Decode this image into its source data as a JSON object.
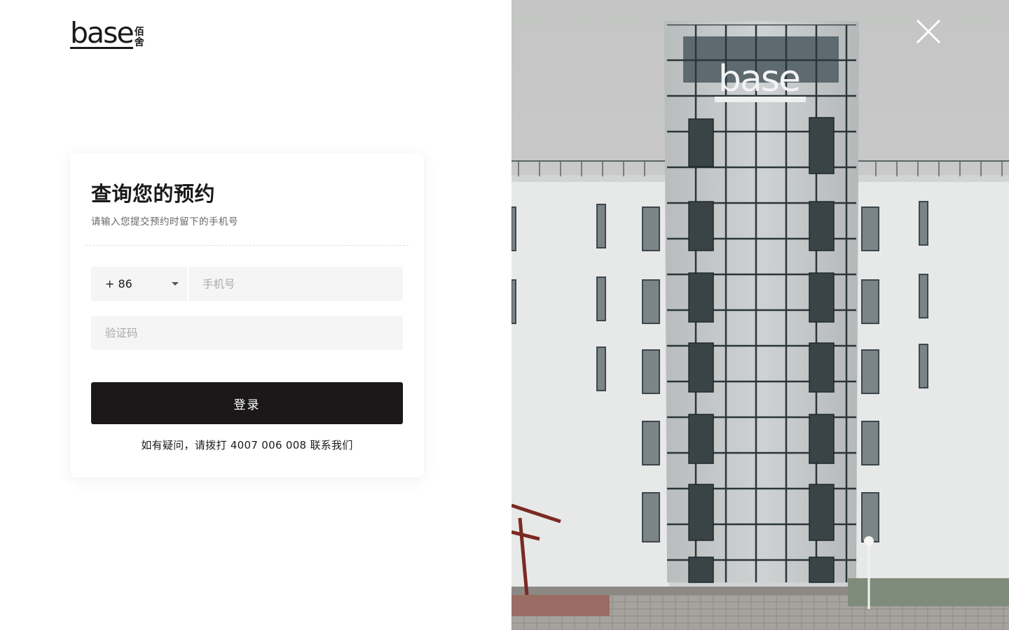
{
  "brand": {
    "logo_word": "base",
    "logo_cn_top": "佰",
    "logo_cn_bottom": "舍"
  },
  "form": {
    "title": "查询您的预约",
    "subtitle": "请输入您提交预约时留下的手机号",
    "country_code": "+ 86",
    "phone_placeholder": "手机号",
    "code_placeholder": "验证码",
    "submit_label": "登录",
    "help_text": "如有疑问，请拨打 4007 006 008 联系我们"
  },
  "photo": {
    "building_sign": "base"
  },
  "icons": {
    "close": "close-icon",
    "caret": "chevron-down-icon"
  },
  "colors": {
    "primary_button": "#1a1819",
    "input_bg": "#f5f5f5",
    "text": "#1a1a1a",
    "muted_text": "#666666"
  }
}
